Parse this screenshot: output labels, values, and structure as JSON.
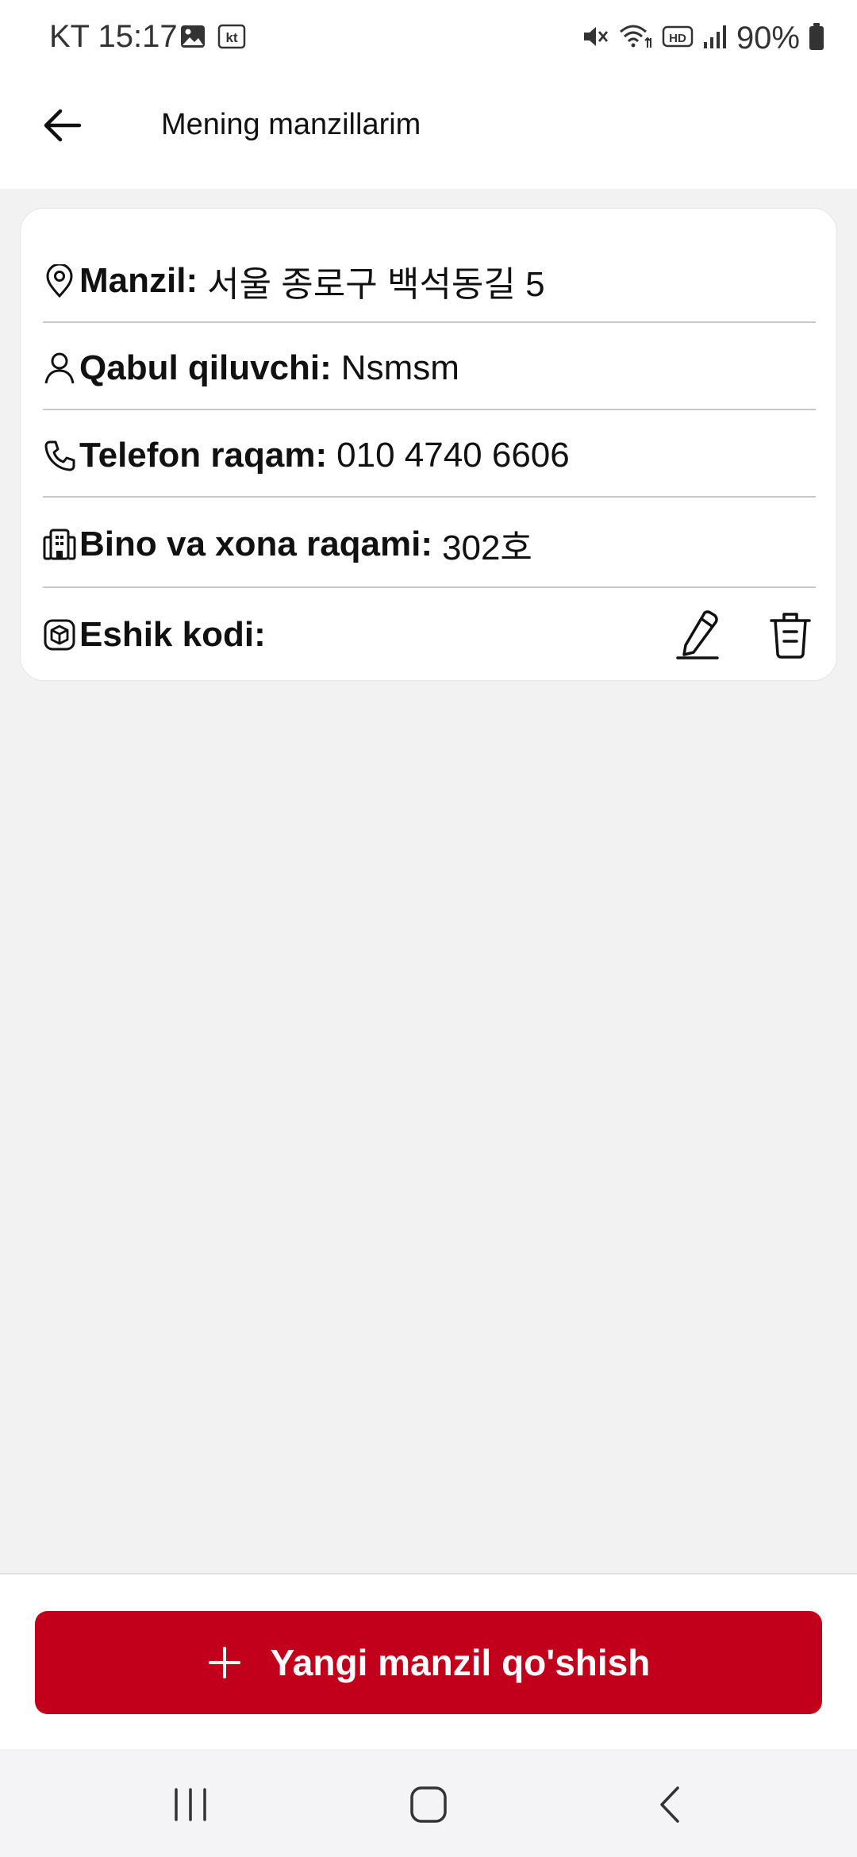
{
  "status_bar": {
    "time": "KT 15:17",
    "battery": "90%",
    "left_icons": [
      "image-icon",
      "kt-icon"
    ],
    "right_icons": [
      "mute-icon",
      "wifi-icon",
      "hd-icon",
      "signal-icon",
      "battery-icon"
    ]
  },
  "header": {
    "title": "Mening manzillarim",
    "back_icon": "arrow-left-icon"
  },
  "address": {
    "rows": [
      {
        "icon": "location-pin-icon",
        "label": "Manzil:",
        "value": "서울 종로구 백석동길 5"
      },
      {
        "icon": "person-icon",
        "label": "Qabul qiluvchi:",
        "value": "Nsmsm"
      },
      {
        "icon": "phone-icon",
        "label": "Telefon raqam:",
        "value": "010 4740 6606"
      },
      {
        "icon": "building-icon",
        "label": "Bino va xona raqami:",
        "value": "302호"
      },
      {
        "icon": "box-icon",
        "label": "Eshik kodi:",
        "value": ""
      }
    ],
    "actions": [
      "edit-icon",
      "trash-icon"
    ]
  },
  "footer": {
    "add_button_label": "Yangi manzil qo'shish",
    "add_icon": "plus-icon",
    "accent_color": "#c3001b"
  },
  "nav_bar": {
    "buttons": [
      "recents-icon",
      "home-icon",
      "back-icon"
    ]
  }
}
